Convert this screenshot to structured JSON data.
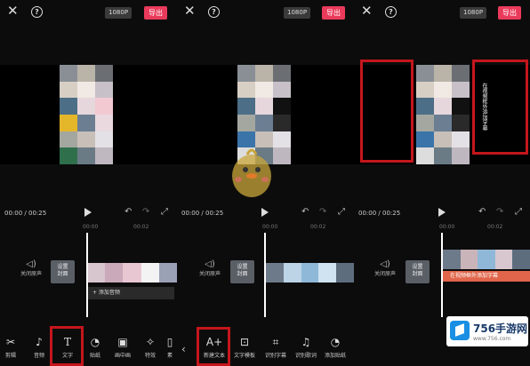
{
  "panels": [
    {
      "resolution": "1080P",
      "export": "导出",
      "time_current": "00:00",
      "time_total": "00:25",
      "ruler": [
        "00:00",
        "00:02"
      ],
      "mute_label": "关闭原声",
      "cover_label": "设置\n封面",
      "add_audio": "+ 添加音频",
      "tools": [
        "剪辑",
        "音频",
        "文字",
        "贴纸",
        "画中画",
        "特效",
        "素"
      ]
    },
    {
      "resolution": "1080P",
      "export": "导出",
      "time_current": "00:00",
      "time_total": "00:25",
      "ruler": [
        "00:00",
        "00:02"
      ],
      "mute_label": "关闭原声",
      "cover_label": "设置\n封面",
      "tools": [
        "新建文本",
        "文字模板",
        "识别字幕",
        "识别歌词",
        "添加贴纸"
      ]
    },
    {
      "resolution": "1080P",
      "export": "导出",
      "time_current": "00:00",
      "time_total": "00:25",
      "ruler": [
        "00:00",
        "00:02"
      ],
      "mute_label": "关闭原声",
      "cover_label": "设置\n封面",
      "caption_overlay": "在视频框外添加字幕",
      "caption_track": "在视频框外添加字幕"
    }
  ],
  "icons": {
    "tools_panel1": [
      "scissors-icon",
      "music-note-icon",
      "text-icon",
      "sticker-icon",
      "picture-in-picture-icon",
      "effects-icon",
      "more-icon"
    ],
    "tools_panel2": [
      "new-text-icon",
      "text-template-icon",
      "recognize-subtitles-icon",
      "recognize-lyrics-icon",
      "add-sticker-icon"
    ]
  },
  "watermark": {
    "name": "756手游网",
    "url": "www.756.com"
  },
  "colors": {
    "accent": "#ea3a5b",
    "highlight": "#c4161c",
    "caption": "#e0654a"
  }
}
